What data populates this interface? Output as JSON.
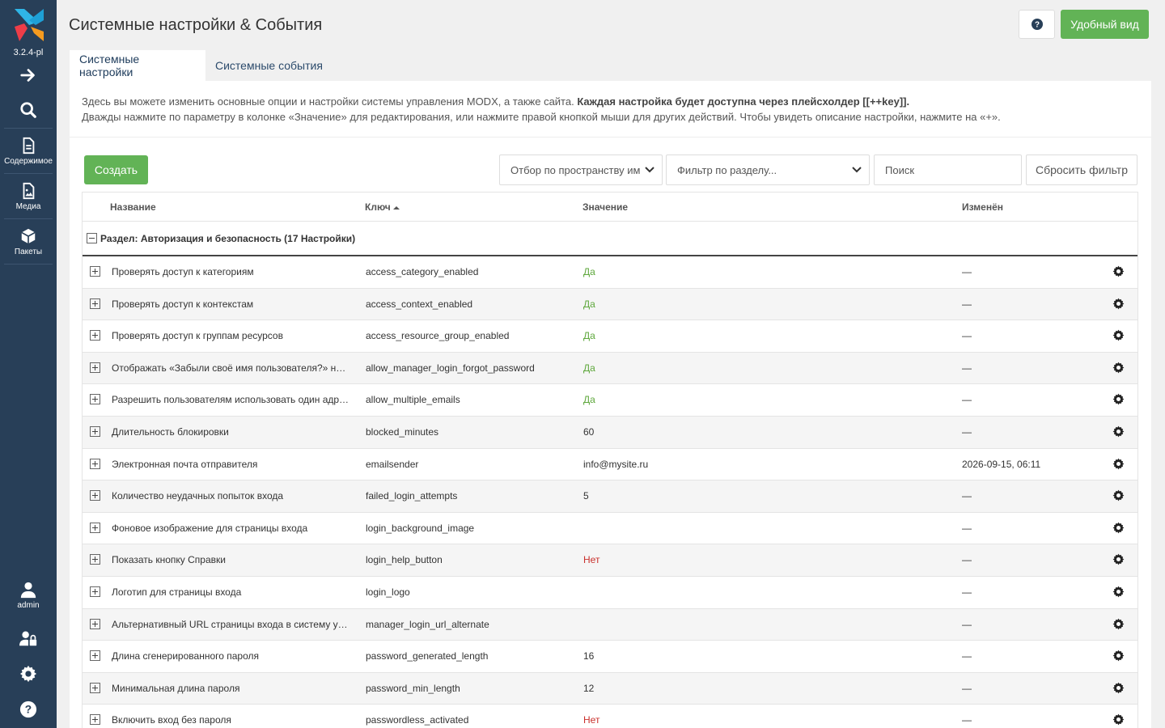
{
  "sidebar": {
    "version": "3.2.4-pl",
    "content_label": "Содержимое",
    "media_label": "Медиа",
    "packages_label": "Пакеты",
    "user_label": "admin"
  },
  "header": {
    "title": "Системные настройки & События",
    "view_button": "Удобный вид"
  },
  "tabs": [
    {
      "label": "Системные настройки"
    },
    {
      "label": "Системные события"
    }
  ],
  "description": {
    "line1_plain": "Здесь вы можете изменить основные опции и настройки системы управления MODX, а также сайта.",
    "line1_bold": "Каждая настройка будет доступна через плейсхолдер [[++key]].",
    "line2": "Дважды нажмите по параметру в колонке «Значение» для редактирования, или нажмите правой кнопкой мыши для других действий. Чтобы увидеть описание настройки, нажмите на «+»."
  },
  "toolbar": {
    "create_label": "Создать",
    "namespace_filter": "Отбор по пространству им",
    "area_filter": "Фильтр по разделу...",
    "search_placeholder": "Поиск",
    "reset_label": "Сбросить фильтр"
  },
  "grid": {
    "columns": {
      "name": "Название",
      "key": "Ключ",
      "value": "Значение",
      "modified": "Изменён"
    },
    "group_label": "Раздел: Авторизация и безопасность (17 Настройки)",
    "rows": [
      {
        "name": "Проверять доступ к категориям",
        "key": "access_category_enabled",
        "value": "Да",
        "modified": "—"
      },
      {
        "name": "Проверять доступ к контекстам",
        "key": "access_context_enabled",
        "value": "Да",
        "modified": "—"
      },
      {
        "name": "Проверять доступ к группам ресурсов",
        "key": "access_resource_group_enabled",
        "value": "Да",
        "modified": "—"
      },
      {
        "name": "Отображать «Забыли своё имя пользователя?» на странице входа",
        "key": "allow_manager_login_forgot_password",
        "value": "Да",
        "modified": "—"
      },
      {
        "name": "Разрешить пользователям использовать один адрес электронной почты",
        "key": "allow_multiple_emails",
        "value": "Да",
        "modified": "—"
      },
      {
        "name": "Длительность блокировки",
        "key": "blocked_minutes",
        "value": "60",
        "modified": "—"
      },
      {
        "name": "Электронная почта отправителя",
        "key": "emailsender",
        "value": "info@mysite.ru",
        "modified": "2026-09-15, 06:11"
      },
      {
        "name": "Количество неудачных попыток входа",
        "key": "failed_login_attempts",
        "value": "5",
        "modified": "—"
      },
      {
        "name": "Фоновое изображение для страницы входа",
        "key": "login_background_image",
        "value": "",
        "modified": "—"
      },
      {
        "name": "Показать кнопку Справки",
        "key": "login_help_button",
        "value": "Нет",
        "modified": "—"
      },
      {
        "name": "Логотип для страницы входа",
        "key": "login_logo",
        "value": "",
        "modified": "—"
      },
      {
        "name": "Альтернативный URL страницы входа в систему управления",
        "key": "manager_login_url_alternate",
        "value": "",
        "modified": "—"
      },
      {
        "name": "Длина сгенерированного пароля",
        "key": "password_generated_length",
        "value": "16",
        "modified": "—"
      },
      {
        "name": "Минимальная длина пароля",
        "key": "password_min_length",
        "value": "12",
        "modified": "—"
      },
      {
        "name": "Включить вход без пароля",
        "key": "passwordless_activated",
        "value": "Нет",
        "modified": "—"
      }
    ]
  },
  "colors": {
    "sidebar_bg": "#283f58",
    "primary_button": "#62b356",
    "yes_value": "#5fa83d",
    "no_value": "#c9302c"
  }
}
